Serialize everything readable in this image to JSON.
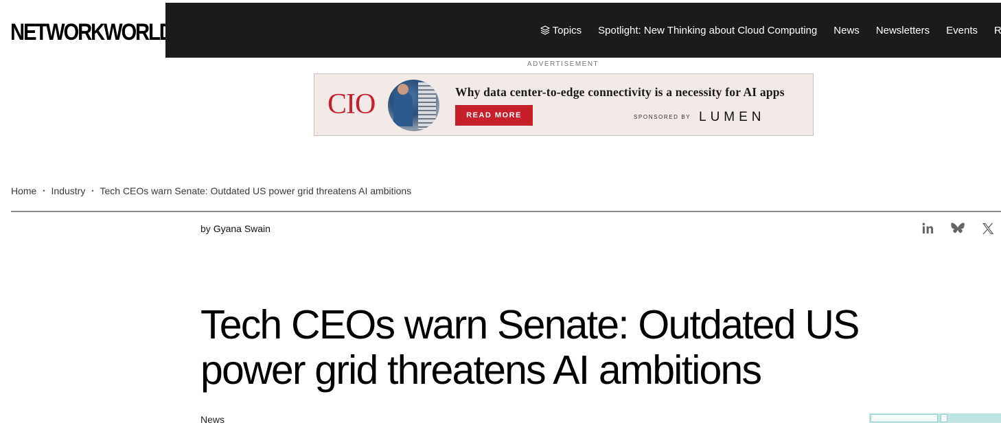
{
  "site": {
    "logo_text": "NETWORKWORLD"
  },
  "nav": {
    "items": [
      {
        "label": "Topics",
        "icon": "layers-icon"
      },
      {
        "label": "Spotlight: New Thinking about Cloud Computing"
      },
      {
        "label": "News"
      },
      {
        "label": "Newsletters"
      },
      {
        "label": "Events"
      },
      {
        "label": "R"
      }
    ]
  },
  "ad": {
    "label": "ADVERTISEMENT",
    "brand": "CIO",
    "headline": "Why data center-to-edge connectivity is a necessity for AI apps",
    "button": "READ MORE",
    "sponsored_by": "SPONSORED BY",
    "sponsor": "LUMEN",
    "brand_color": "#c8202b"
  },
  "breadcrumb": {
    "items": [
      "Home",
      "Industry",
      "Tech CEOs warn Senate: Outdated US power grid threatens AI ambitions"
    ],
    "separator": "•"
  },
  "article": {
    "by_prefix": "by",
    "author": "Gyana Swain",
    "title": "Tech CEOs warn Senate: Outdated US power grid threatens AI ambitions",
    "category": "News"
  },
  "share": [
    "linkedin-icon",
    "bluesky-icon",
    "x-icon"
  ]
}
